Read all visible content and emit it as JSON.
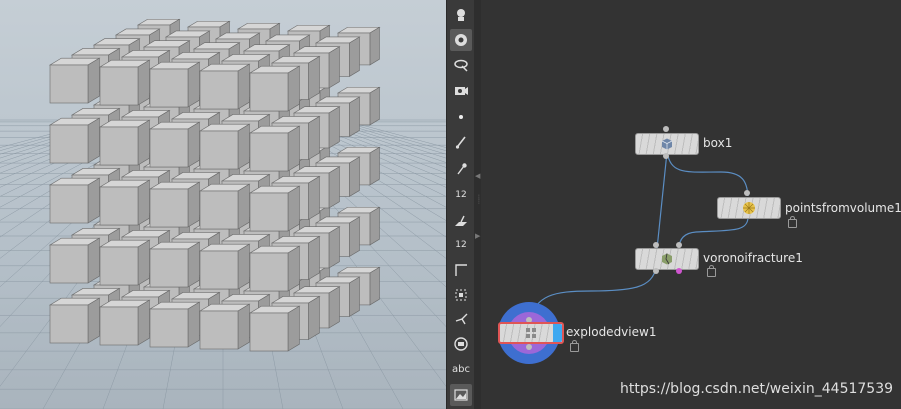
{
  "toolbar": {
    "items": [
      {
        "name": "handle-tool-icon"
      },
      {
        "name": "view-tool-icon"
      },
      {
        "name": "select-mode-icon"
      },
      {
        "name": "display-options-icon"
      },
      {
        "name": "point-icon"
      },
      {
        "name": "brush-icon"
      },
      {
        "name": "probe-icon"
      },
      {
        "name": "point-numbers-icon",
        "text": "12"
      },
      {
        "name": "normals-icon"
      },
      {
        "name": "primitive-numbers-icon",
        "text": "12"
      },
      {
        "name": "uv-corner-icon"
      },
      {
        "name": "bounding-box-icon"
      },
      {
        "name": "pin-icon"
      },
      {
        "name": "record-icon"
      },
      {
        "name": "text-label-icon",
        "text": "abc"
      },
      {
        "name": "background-image-icon"
      }
    ]
  },
  "network": {
    "nodes": [
      {
        "id": "box1",
        "label": "box1",
        "icon": "box-icon"
      },
      {
        "id": "pointsfromvolume1",
        "label": "pointsfromvolume1",
        "icon": "sphere-points-icon"
      },
      {
        "id": "voronoifracture1",
        "label": "voronoifracture1",
        "icon": "fracture-icon"
      },
      {
        "id": "explodedview1",
        "label": "explodedview1",
        "icon": "explode-icon"
      }
    ],
    "colors": {
      "wire": "#5b8ec4",
      "display_flag": "#3ea8f0",
      "selected_outline": "#e05555",
      "display_ring": "#3e6fd0",
      "template_ring": "#9b67d8"
    }
  },
  "watermark": "https://blog.csdn.net/weixin_44517539"
}
